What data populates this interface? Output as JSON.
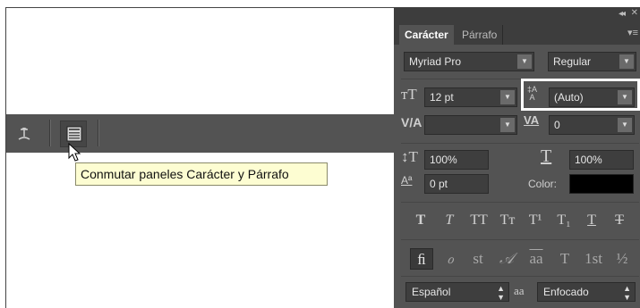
{
  "tooltip": {
    "text": "Conmutar paneles Carácter y Párrafo"
  },
  "toolbar": {
    "warp_icon": "warp-text-icon",
    "panels_icon": "character-paragraph-panels-icon"
  },
  "panel": {
    "tabs": [
      {
        "label": "Carácter"
      },
      {
        "label": "Párrafo"
      }
    ],
    "font_family": "Myriad Pro",
    "font_style": "Regular",
    "font_size": "12 pt",
    "leading": "(Auto)",
    "kerning": "",
    "tracking": "0",
    "vertical_scale": "100%",
    "horizontal_scale": "100%",
    "baseline_shift": "0 pt",
    "color_label": "Color:",
    "color_value": "#000000",
    "style_buttons": [
      "T",
      "T",
      "TT",
      "Tт",
      "T¹",
      "T₁",
      "T",
      "T"
    ],
    "opentype_buttons": [
      "ﬁ",
      "ℴ",
      "st",
      "𝒜",
      "aa",
      "T",
      "1st",
      "½"
    ],
    "language": "Español",
    "antialias_icon_label": "aa",
    "antialias": "Enfocado"
  }
}
